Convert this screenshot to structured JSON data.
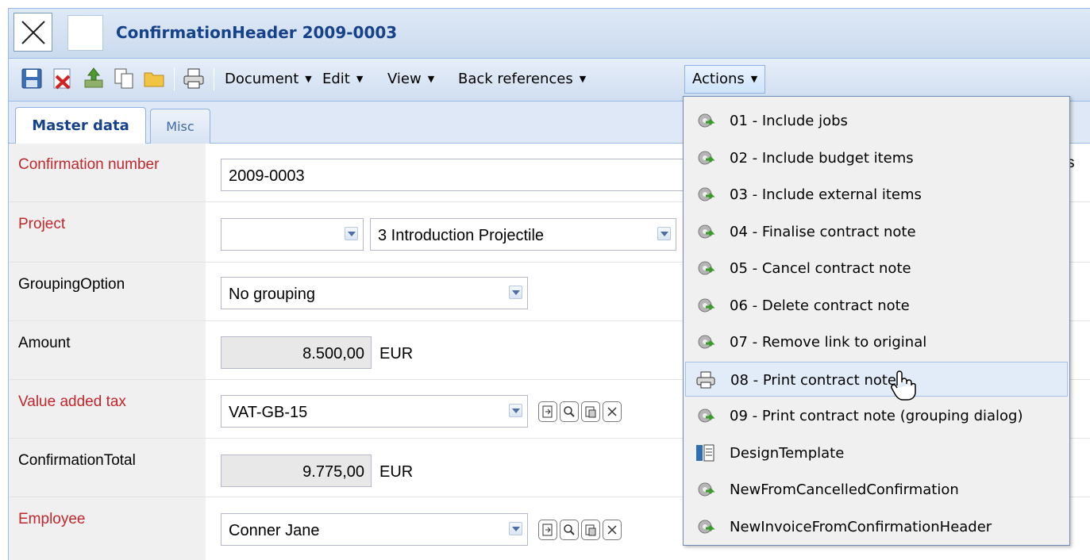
{
  "window": {
    "title": "ConfirmationHeader 2009-0003"
  },
  "toolbar": {
    "icons": [
      "save-icon",
      "delete-icon",
      "upload-icon",
      "copy-icon",
      "folder-icon",
      "print-icon"
    ],
    "menus": [
      {
        "label": "Document",
        "icon": "dropdown-arrow"
      },
      {
        "label": "Edit",
        "icon": "dropdown-arrow"
      },
      {
        "label": "View",
        "icon": "dropdown-arrow"
      },
      {
        "label": "Back references",
        "icon": "dropdown-arrow"
      },
      {
        "label": "Actions",
        "icon": "dropdown-arrow",
        "active": true
      }
    ]
  },
  "tabs": [
    {
      "label": "Master data",
      "active": true
    },
    {
      "label": "Misc",
      "active": false
    }
  ],
  "form": {
    "confirmation_number": {
      "label": "Confirmation number",
      "value": "2009-0003"
    },
    "project": {
      "label": "Project",
      "value_left": "",
      "value": "3 Introduction Projectile"
    },
    "grouping_option": {
      "label": "GroupingOption",
      "value": "No grouping"
    },
    "amount": {
      "label": "Amount",
      "value": "8.500,00",
      "unit": "EUR"
    },
    "vat": {
      "label": "Value added tax",
      "value": "VAT-GB-15"
    },
    "confirmation_total": {
      "label": "ConfirmationTotal",
      "value": "9.775,00",
      "unit": "EUR"
    },
    "employee": {
      "label": "Employee",
      "value": "Conner Jane"
    },
    "cut_off_text": "s"
  },
  "actions_menu": {
    "items": [
      {
        "label": "01 - Include jobs",
        "icon": "gear-icon"
      },
      {
        "label": "02 - Include budget items",
        "icon": "gear-icon"
      },
      {
        "label": "03 - Include external items",
        "icon": "gear-icon"
      },
      {
        "label": "04 - Finalise contract note",
        "icon": "gear-icon"
      },
      {
        "label": "05 - Cancel contract note",
        "icon": "gear-icon"
      },
      {
        "label": "06 - Delete contract note",
        "icon": "gear-icon"
      },
      {
        "label": "07 - Remove link to original",
        "icon": "gear-icon"
      },
      {
        "label": "08 - Print contract note",
        "icon": "print-icon",
        "hover": true
      },
      {
        "label": "09 - Print contract note (grouping dialog)",
        "icon": "gear-icon"
      },
      {
        "label": "DesignTemplate",
        "icon": "template-icon"
      },
      {
        "label": "NewFromCancelledConfirmation",
        "icon": "gear-icon"
      },
      {
        "label": "NewInvoiceFromConfirmationHeader",
        "icon": "gear-icon"
      }
    ]
  },
  "colors": {
    "required_label": "#c0272d",
    "title_text": "#15428b",
    "hover_bg": "#e2ecf9"
  }
}
